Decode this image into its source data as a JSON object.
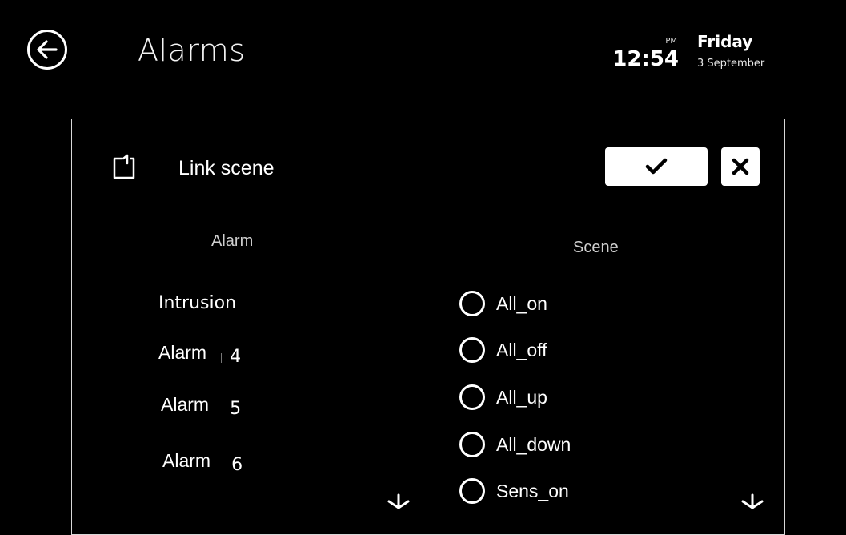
{
  "header": {
    "title": "Alarms",
    "ampm": "PM",
    "time": "12:54",
    "day": "Friday",
    "date": "3 September"
  },
  "dialog": {
    "title": "Link scene",
    "alarm_column_header": "Alarm",
    "scene_column_header": "Scene",
    "alarms": [
      {
        "label": "Intrusion",
        "number": ""
      },
      {
        "label": "Alarm",
        "number": "4"
      },
      {
        "label": "Alarm",
        "number": "5"
      },
      {
        "label": "Alarm",
        "number": "6"
      }
    ],
    "scenes": [
      {
        "label": "All_on",
        "selected": false
      },
      {
        "label": "All_off",
        "selected": false
      },
      {
        "label": "All_up",
        "selected": false
      },
      {
        "label": "All_down",
        "selected": false
      },
      {
        "label": "Sens_on",
        "selected": false
      }
    ]
  },
  "icons": {
    "back": "arrow-left-circle-icon",
    "link": "link-scene-icon",
    "confirm": "checkmark-icon",
    "close": "close-icon",
    "scroll_down": "chevron-down-icon"
  }
}
